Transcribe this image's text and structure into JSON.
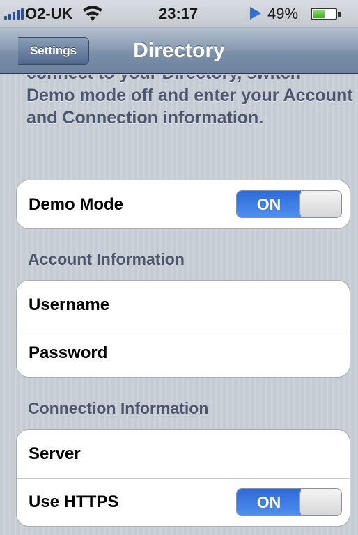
{
  "status_bar": {
    "carrier": "O2-UK",
    "time": "23:17",
    "battery_percent": "49%",
    "battery_level": 0.49,
    "icons": [
      "signal-icon",
      "wifi-icon",
      "play-icon",
      "battery-icon"
    ]
  },
  "nav": {
    "back_label": "Settings",
    "title": "Directory"
  },
  "description": "connect to your Directory, switch Demo mode off and enter your Account and Connection information.",
  "demo": {
    "label": "Demo Mode",
    "toggle": "ON"
  },
  "account": {
    "header": "Account Information",
    "username_label": "Username",
    "password_label": "Password"
  },
  "connection": {
    "header": "Connection Information",
    "server_label": "Server",
    "https_label": "Use HTTPS",
    "https_toggle": "ON"
  },
  "colors": {
    "toggle_on": "#2f6bd7",
    "nav_bar": "#7d90a9",
    "section_text": "#4c566c",
    "background": "#c5ccd4"
  }
}
